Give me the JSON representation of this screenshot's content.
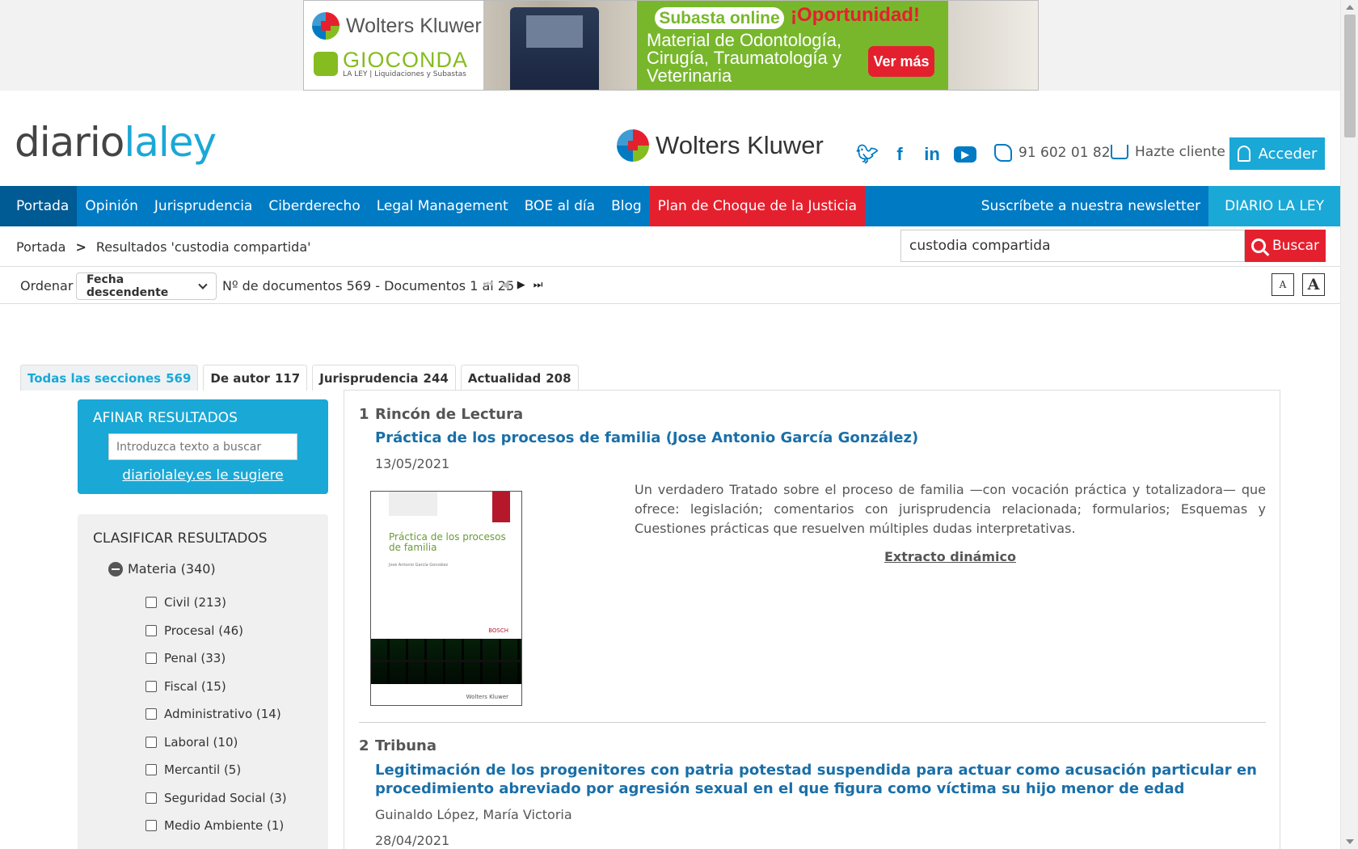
{
  "ad": {
    "brand": "Wolters Kluwer",
    "gioconda": "GIOCONDA",
    "gioconda_sub": "LA LEY | Liquidaciones y Subastas",
    "pill": "Subasta online",
    "opportunity": "¡Oportunidad!",
    "body": "Material de Odontología, Cirugía, Traumatología y Veterinaria",
    "cta": "Ver más"
  },
  "header": {
    "logo_a": "diario",
    "logo_b": "laley",
    "brand": "Wolters Kluwer",
    "phone": "91 602 01 82",
    "hazte": "Hazte cliente",
    "acceder": "Acceder"
  },
  "nav": {
    "items": [
      "Portada",
      "Opinión",
      "Jurisprudencia",
      "Ciberderecho",
      "Legal Management",
      "BOE al día",
      "Blog"
    ],
    "highlight": "Plan de Choque de la Justicia",
    "newsletter": "Suscríbete a nuestra newsletter",
    "diario": "DIARIO LA LEY"
  },
  "breadcrumb": {
    "home": "Portada",
    "sep": ">",
    "current": "Resultados 'custodia compartida'"
  },
  "search": {
    "value": "custodia compartida",
    "button": "Buscar"
  },
  "sortbar": {
    "label": "Ordenar",
    "selected": "Fecha descendente",
    "count_text": "Nº de documentos 569 - Documentos 1 al 25",
    "font_small": "A",
    "font_big": "A"
  },
  "tabs": [
    {
      "label": "Todas las secciones",
      "count": "569"
    },
    {
      "label": "De autor",
      "count": "117"
    },
    {
      "label": "Jurisprudencia",
      "count": "244"
    },
    {
      "label": "Actualidad",
      "count": "208"
    }
  ],
  "afinar": {
    "title": "AFINAR RESULTADOS",
    "placeholder": "Introduzca texto a buscar",
    "link": "diariolaley.es le sugiere"
  },
  "clasificar": {
    "title": "CLASIFICAR RESULTADOS",
    "group": "Materia (340)",
    "items": [
      "Civil (213)",
      "Procesal (46)",
      "Penal (33)",
      "Fiscal (15)",
      "Administrativo (14)",
      "Laboral (10)",
      "Mercantil (5)",
      "Seguridad Social (3)",
      "Medio Ambiente (1)"
    ]
  },
  "results": [
    {
      "num": "1",
      "section": "Rincón de Lectura",
      "title": "Práctica de los procesos de familia (Jose Antonio García González)",
      "date": "13/05/2021",
      "abstract": "Un verdadero Tratado sobre el proceso de familia —con vocación práctica y totalizadora— que ofrece: legislación; comentarios con jurisprudencia relacionada; formularios; Esquemas y Cuestiones prácticas que resuelven múltiples dudas interpretativas.",
      "extracto": "Extracto dinámico",
      "book_title": "Práctica de los procesos de familia",
      "book_author": "José Antonio García González",
      "book_publisher": "BOSCH",
      "book_brand": "Wolters Kluwer"
    },
    {
      "num": "2",
      "section": "Tribuna",
      "title": "Legitimación de los progenitores con patria potestad suspendida para actuar como acusación particular en procedimiento abreviado por agresión sexual en el que figura como víctima su hijo menor de edad",
      "author": "Guinaldo López, María Victoria",
      "date": "28/04/2021"
    }
  ]
}
